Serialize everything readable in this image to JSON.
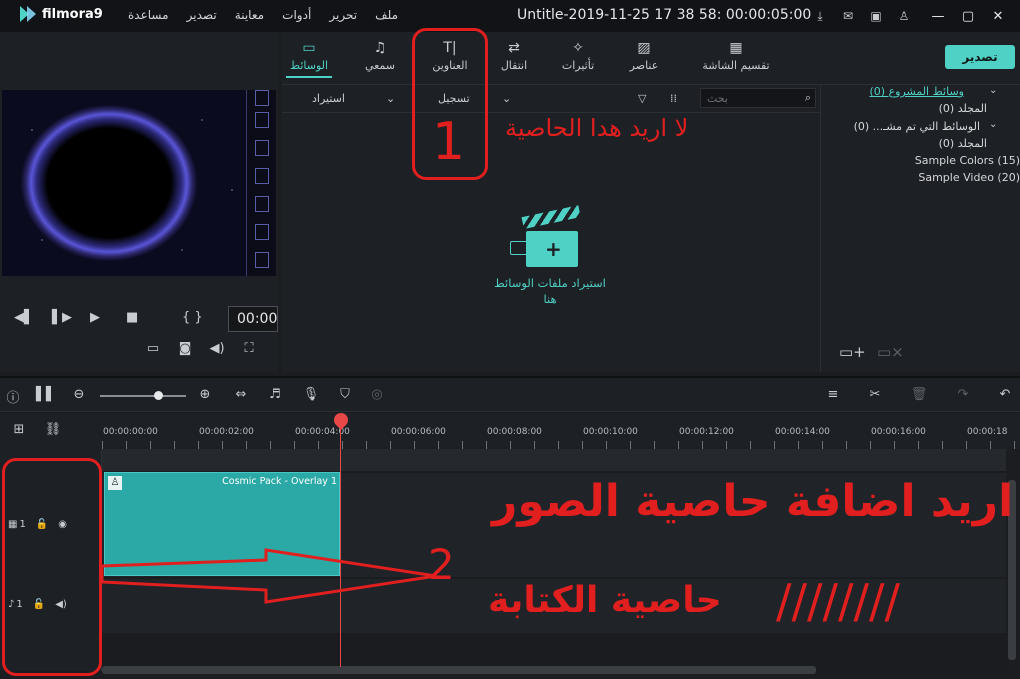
{
  "app": {
    "logo_text": "filmora9",
    "window_title": "Untitle-2019-11-25 17 38 58:  00:00:05:00"
  },
  "menu": [
    "ملف",
    "تحرير",
    "أدوات",
    "معاينة",
    "تصدير",
    "مساعدة"
  ],
  "title_icons": [
    "download-icon",
    "mail-icon",
    "save-icon",
    "user-icon"
  ],
  "window_controls": [
    "minimize-icon",
    "maximize-icon",
    "close-icon"
  ],
  "preview": {
    "timecode": "00:00",
    "controls": [
      "prev-frame-icon",
      "step-icon",
      "play-icon",
      "stop-icon",
      "mark-in-out-icon"
    ]
  },
  "tabs": [
    {
      "label": "الوسائط",
      "icon": "folder-icon",
      "active": true
    },
    {
      "label": "سمعي",
      "icon": "music-icon",
      "active": false
    },
    {
      "label": "العناوين",
      "icon": "text-icon",
      "active": false
    },
    {
      "label": "انتقال",
      "icon": "transition-icon",
      "active": false
    },
    {
      "label": "تأثيرات",
      "icon": "effects-icon",
      "active": false
    },
    {
      "label": "عناصر",
      "icon": "image-icon",
      "active": false
    },
    {
      "label": "تقسيم الشاشة",
      "icon": "split-screen-icon",
      "active": false
    }
  ],
  "export_button": "تصدير",
  "media_toolbar": {
    "import_label": "استيراد",
    "record_label": "تسجيل",
    "search_placeholder": "بحث"
  },
  "media_empty": {
    "line1": "استيراد ملفات الوسائط",
    "line2": "هنا"
  },
  "library": {
    "items": [
      {
        "label": "وسائط المشروع (0)",
        "active": true
      },
      {
        "label": "المجلد (0)",
        "active": false
      },
      {
        "label": "الوسائط التي تم مشـ... (0)",
        "active": false
      },
      {
        "label": "المجلد (0)",
        "active": false
      },
      {
        "label": "Sample Colors (15)",
        "active": false
      },
      {
        "label": "Sample Video (20)",
        "active": false
      }
    ]
  },
  "ruler": {
    "labels": [
      "00:00:00:00",
      "00:00:02:00",
      "00:00:04:00",
      "00:00:06:00",
      "00:00:08:00",
      "00:00:10:00",
      "00:00:12:00",
      "00:00:14:00",
      "00:00:16:00",
      "00:00:18"
    ]
  },
  "tracks": {
    "video_track_num": "1",
    "audio_track_num": "1",
    "clip_label": "Cosmic Pack - Overlay 1"
  },
  "annotations": {
    "note1": "لا اريد هدا الحاصية",
    "number1": "1",
    "note2": "اريد اضافة حاصية الصور",
    "number2": "2",
    "note3": "حاصية الكتابة",
    "slashes": "////////"
  },
  "colors": {
    "accent": "#4fd1c5",
    "annotation": "#e11f1f",
    "background": "#1b1d21"
  }
}
